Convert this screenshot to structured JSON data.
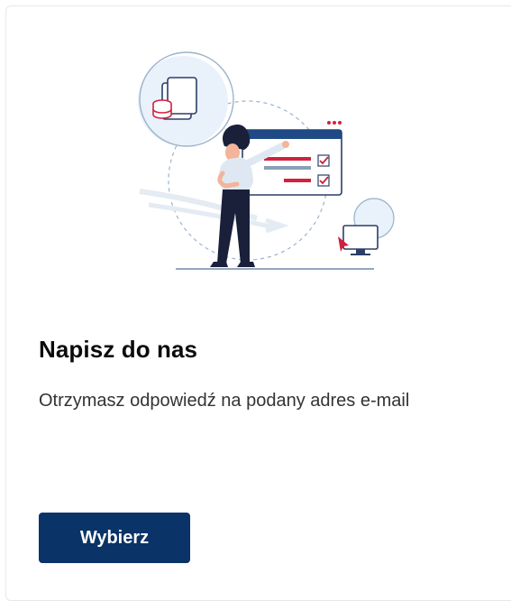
{
  "card": {
    "title": "Napisz do nas",
    "description": "Otrzymasz odpowiedź na podany adres e-mail",
    "button_label": "Wybierz"
  },
  "colors": {
    "primary": "#0a3468",
    "accent_red": "#d1213d",
    "text": "#0b0b0b",
    "text_secondary": "#333333"
  },
  "icons": [
    "person-presenting-illustration",
    "document-database-icon",
    "checklist-window-icon",
    "monitor-cursor-icon"
  ]
}
